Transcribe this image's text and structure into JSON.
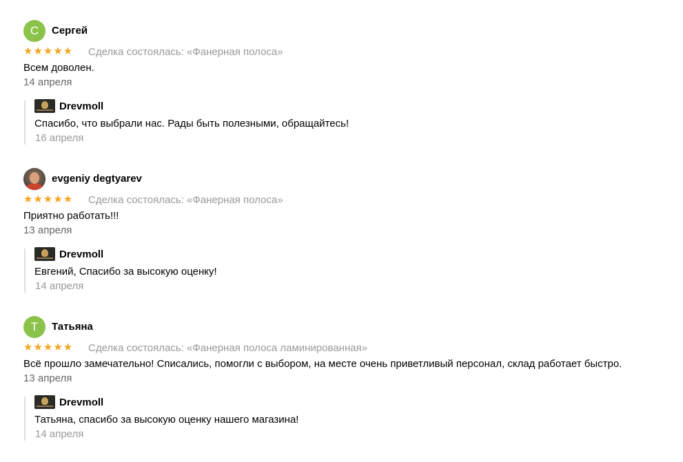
{
  "reviews": [
    {
      "author": "Сергей",
      "avatar_letter": "С",
      "rating": "★★★★★",
      "deal": "Сделка состоялась: «Фанерная полоса»",
      "text": "Всем доволен.",
      "date": "14 апреля",
      "reply": {
        "shop": "Drevmoll",
        "text": "Спасибо, что выбрали нас. Рады быть полезными, обращайтесь!",
        "date": "16 апреля"
      }
    },
    {
      "author": "evgeniy degtyarev",
      "rating": "★★★★★",
      "deal": "Сделка состоялась: «Фанерная полоса»",
      "text": "Приятно работать!!!",
      "date": "13 апреля",
      "reply": {
        "shop": "Drevmoll",
        "text": "Евгений, Спасибо за высокую оценку!",
        "date": "14 апреля"
      }
    },
    {
      "author": "Татьяна",
      "avatar_letter": "Т",
      "rating": "★★★★★",
      "deal": "Сделка состоялась: «Фанерная полоса ламинированная»",
      "text": "Всё прошло замечательно! Списались, помогли с выбором, на месте очень приветливый персонал, склад работает быстро.",
      "date": "13 апреля",
      "reply": {
        "shop": "Drevmoll",
        "text": "Татьяна, спасибо за высокую оценку нашего магазина!",
        "date": "14 апреля"
      }
    }
  ],
  "colors": {
    "star": "#f7a41d",
    "avatar_bg": "#8bc34a",
    "muted": "#999999",
    "reply_bar": "#e0e0e0"
  }
}
